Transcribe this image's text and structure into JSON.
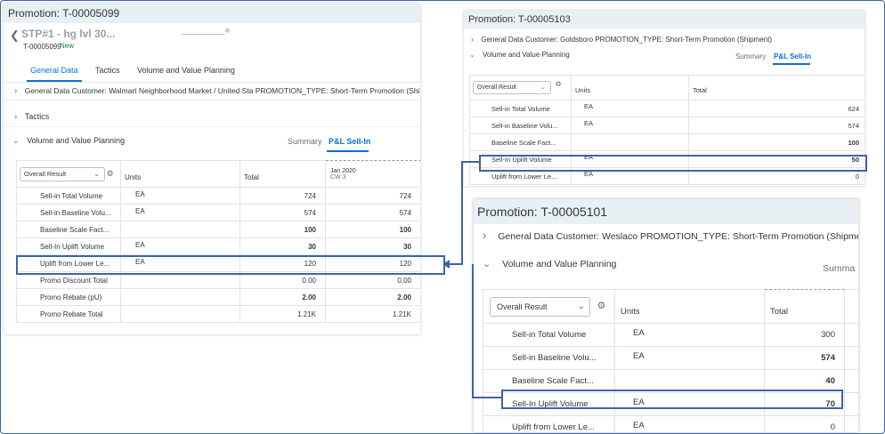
{
  "panel1": {
    "title": "Promotion: T-00005099",
    "object_title": "STP#1 - hg lvl 30...",
    "object_id": "T-00005099",
    "status": "New",
    "tabs": [
      "General Data",
      "Tactics",
      "Volume and Value Planning"
    ],
    "general_data_line": "General Data  Customer: Walmart Neighborhood Market / United Sta  PROMOTION_TYPE: Short-Term Promotion (Shipment)",
    "tactics_label": "Tactics",
    "vvp_label": "Volume and Value Planning",
    "summary_label": "Summary",
    "pl_label": "P&L Sell-In",
    "dropdown_value": "Overall Result",
    "headers": {
      "units": "Units",
      "total": "Total",
      "period": "Jan 2020",
      "period_sub": "CW 3"
    },
    "rows": [
      {
        "label": "Sell-in Total Volume",
        "units": "EA",
        "total": "724",
        "period": "724",
        "bold": false
      },
      {
        "label": "Sell-in Baseline Volu...",
        "units": "EA",
        "total": "574",
        "period": "574",
        "bold": false
      },
      {
        "label": "Baseline Scale Fact...",
        "units": "",
        "total": "100",
        "period": "100",
        "bold": true
      },
      {
        "label": "Sell-In Uplift Volume",
        "units": "EA",
        "total": "30",
        "period": "30",
        "bold": true
      },
      {
        "label": "Uplift from Lower Le...",
        "units": "EA",
        "total": "120",
        "period": "120",
        "bold": false
      },
      {
        "label": "Promo Discount Total",
        "units": "",
        "total": "0.00",
        "period": "0.00",
        "bold": false
      },
      {
        "label": "Promo Rebate (pU)",
        "units": "",
        "total": "2.00",
        "period": "2.00",
        "bold": true
      },
      {
        "label": "Promo Rebate Total",
        "units": "",
        "total": "1.21K",
        "period": "1.21K",
        "bold": false
      }
    ]
  },
  "panel2": {
    "title": "Promotion: T-00005103",
    "general_data_line": "General Data  Customer: Goldsboro  PROMOTION_TYPE: Short-Term Promotion (Shipment)",
    "vvp_label": "Volume and Value Planning",
    "summary_label": "Summary",
    "pl_label": "P&L Sell-In",
    "dropdown_value": "Overall Result",
    "headers": {
      "units": "Units",
      "total": "Total"
    },
    "rows": [
      {
        "label": "Sell-in Total Volume",
        "units": "EA",
        "total": "624",
        "bold": false
      },
      {
        "label": "Sell-in Baseline Volu...",
        "units": "EA",
        "total": "574",
        "bold": false
      },
      {
        "label": "Baseline Scale Fact...",
        "units": "",
        "total": "100",
        "bold": true
      },
      {
        "label": "Sell-In Uplift Volume",
        "units": "EA",
        "total": "50",
        "bold": true
      },
      {
        "label": "Uplift from Lower Le...",
        "units": "EA",
        "total": "0",
        "bold": false
      }
    ]
  },
  "panel3": {
    "title": "Promotion: T-00005101",
    "general_data_line": "General Data  Customer: Weslaco  PROMOTION_TYPE: Short-Term Promotion (Shipment)",
    "vvp_label": "Volume and Value Planning",
    "summary_label": "Summa",
    "dropdown_value": "Overall Result",
    "headers": {
      "units": "Units",
      "total": "Total"
    },
    "rows": [
      {
        "label": "Sell-in Total Volume",
        "units": "EA",
        "total": "300",
        "bold": false
      },
      {
        "label": "Sell-in Baseline Volu...",
        "units": "EA",
        "total": "574",
        "bold": true
      },
      {
        "label": "Baseline Scale Fact...",
        "units": "",
        "total": "40",
        "bold": true
      },
      {
        "label": "Sell-In Uplift Volume",
        "units": "EA",
        "total": "70",
        "bold": true
      },
      {
        "label": "Uplift from Lower Le...",
        "units": "EA",
        "total": "0",
        "bold": false
      }
    ]
  },
  "colors": {
    "accent": "#0a6ed1",
    "highlight": "#3d64a8",
    "titlebar": "#e9f0f4"
  },
  "icons": {
    "dropdown": "chevron-down-icon",
    "settings": "settings-icon",
    "expand": "chevron-right-icon",
    "collapse": "chevron-down-icon",
    "back": "chevron-left-icon"
  }
}
